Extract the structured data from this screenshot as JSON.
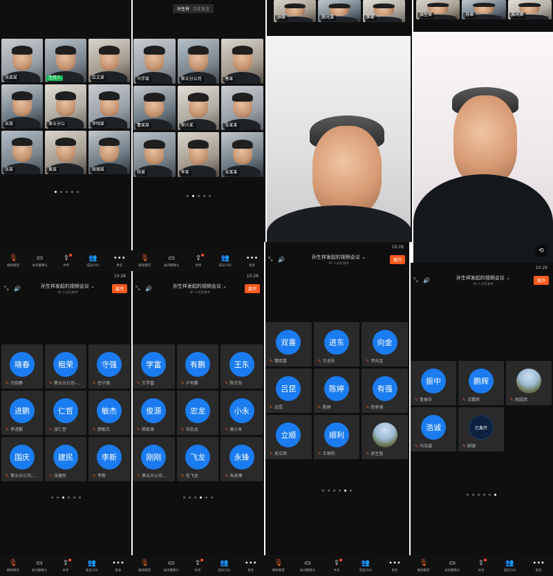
{
  "meeting": {
    "title": "孙生祥发起的视频会议",
    "subtitle": "4P 人员在会中",
    "leave_label": "离开",
    "speaking_name": "孙生祥",
    "speaking_status": "正在发言"
  },
  "status_times": [
    "10:28",
    "10:28",
    "10:28",
    "10:29"
  ],
  "toolbar": [
    {
      "icon": "mic-off-icon",
      "glyph": "🎙",
      "label": "解除静音",
      "red": true
    },
    {
      "icon": "camera-icon",
      "glyph": "▭",
      "label": "关闭摄像头",
      "red": false
    },
    {
      "icon": "share-icon",
      "glyph": "⇪",
      "label": "共享",
      "red": false,
      "badge": true
    },
    {
      "icon": "members-icon",
      "glyph": "👥",
      "label": "成员(50)",
      "red": false
    },
    {
      "icon": "more-icon",
      "glyph": "•••",
      "label": "更多",
      "red": false
    }
  ],
  "face_grid_a": [
    {
      "name": "张某某"
    },
    {
      "name": "主持人",
      "green": true
    },
    {
      "name": "吕文某"
    },
    {
      "name": "宋某"
    },
    {
      "name": "第五分公"
    },
    {
      "name": "李明某"
    },
    {
      "name": "张某"
    },
    {
      "name": "黄某"
    },
    {
      "name": "周德某"
    }
  ],
  "face_grid_b": [
    {
      "name": "马学某"
    },
    {
      "name": "第五分公司"
    },
    {
      "name": "春某"
    },
    {
      "name": "曹某某"
    },
    {
      "name": "郭兴某"
    },
    {
      "name": "张某某"
    },
    {
      "name": "杨某"
    },
    {
      "name": "李某"
    },
    {
      "name": "张某某"
    }
  ],
  "speaker_top_strip": [
    "孙某",
    "陈光某",
    "李某",
    "张生某"
  ],
  "avatars_a": [
    {
      "avatar": "晓春",
      "name": "王晓春"
    },
    {
      "avatar": "租荣",
      "name": "第五分公司-…"
    },
    {
      "avatar": "守强",
      "name": "任守强"
    },
    {
      "avatar": "进鹏",
      "name": "李进鹏"
    },
    {
      "avatar": "仁哲",
      "name": "张仁哲"
    },
    {
      "avatar": "敏杰",
      "name": "廖敏杰"
    },
    {
      "avatar": "国庆",
      "name": "第五分公司-…"
    },
    {
      "avatar": "建民",
      "name": "张建民"
    },
    {
      "avatar": "李新",
      "name": "李新"
    }
  ],
  "avatars_b": [
    {
      "avatar": "学富",
      "name": "王学富"
    },
    {
      "avatar": "有鹏",
      "name": "卢有鹏"
    },
    {
      "avatar": "王东",
      "name": "陈王东"
    },
    {
      "avatar": "俊源",
      "name": "杨俊源"
    },
    {
      "avatar": "忠龙",
      "name": "刘忠龙"
    },
    {
      "avatar": "小永",
      "name": "高小永"
    },
    {
      "avatar": "刚刚",
      "name": "第五分公司…"
    },
    {
      "avatar": "飞龙",
      "name": "任飞龙"
    },
    {
      "avatar": "永锋",
      "name": "朱永锋"
    }
  ],
  "avatars_c": [
    {
      "avatar": "双喜",
      "name": "魏双喜"
    },
    {
      "avatar": "进东",
      "name": "王进东"
    },
    {
      "avatar": "向金",
      "name": "李向金"
    },
    {
      "avatar": "吕昆",
      "name": "吕昆"
    },
    {
      "avatar": "陈婷",
      "name": "陈婷"
    },
    {
      "avatar": "有强",
      "name": "徐有强"
    },
    {
      "avatar": "立顺",
      "name": "吴立顺"
    },
    {
      "avatar": "顺利",
      "name": "王顺利"
    },
    {
      "avatar": "",
      "name": "张生智",
      "photo": true
    }
  ],
  "avatars_d": [
    {
      "avatar": "振中",
      "name": "鲁振中"
    },
    {
      "avatar": "鹏辉",
      "name": "王鹏辉"
    },
    {
      "avatar": "",
      "name": "胡成西",
      "photo": true
    },
    {
      "avatar": "浩诚",
      "name": "马浩诚"
    },
    {
      "avatar": "已离开",
      "name": "顾源",
      "dark": true
    }
  ]
}
